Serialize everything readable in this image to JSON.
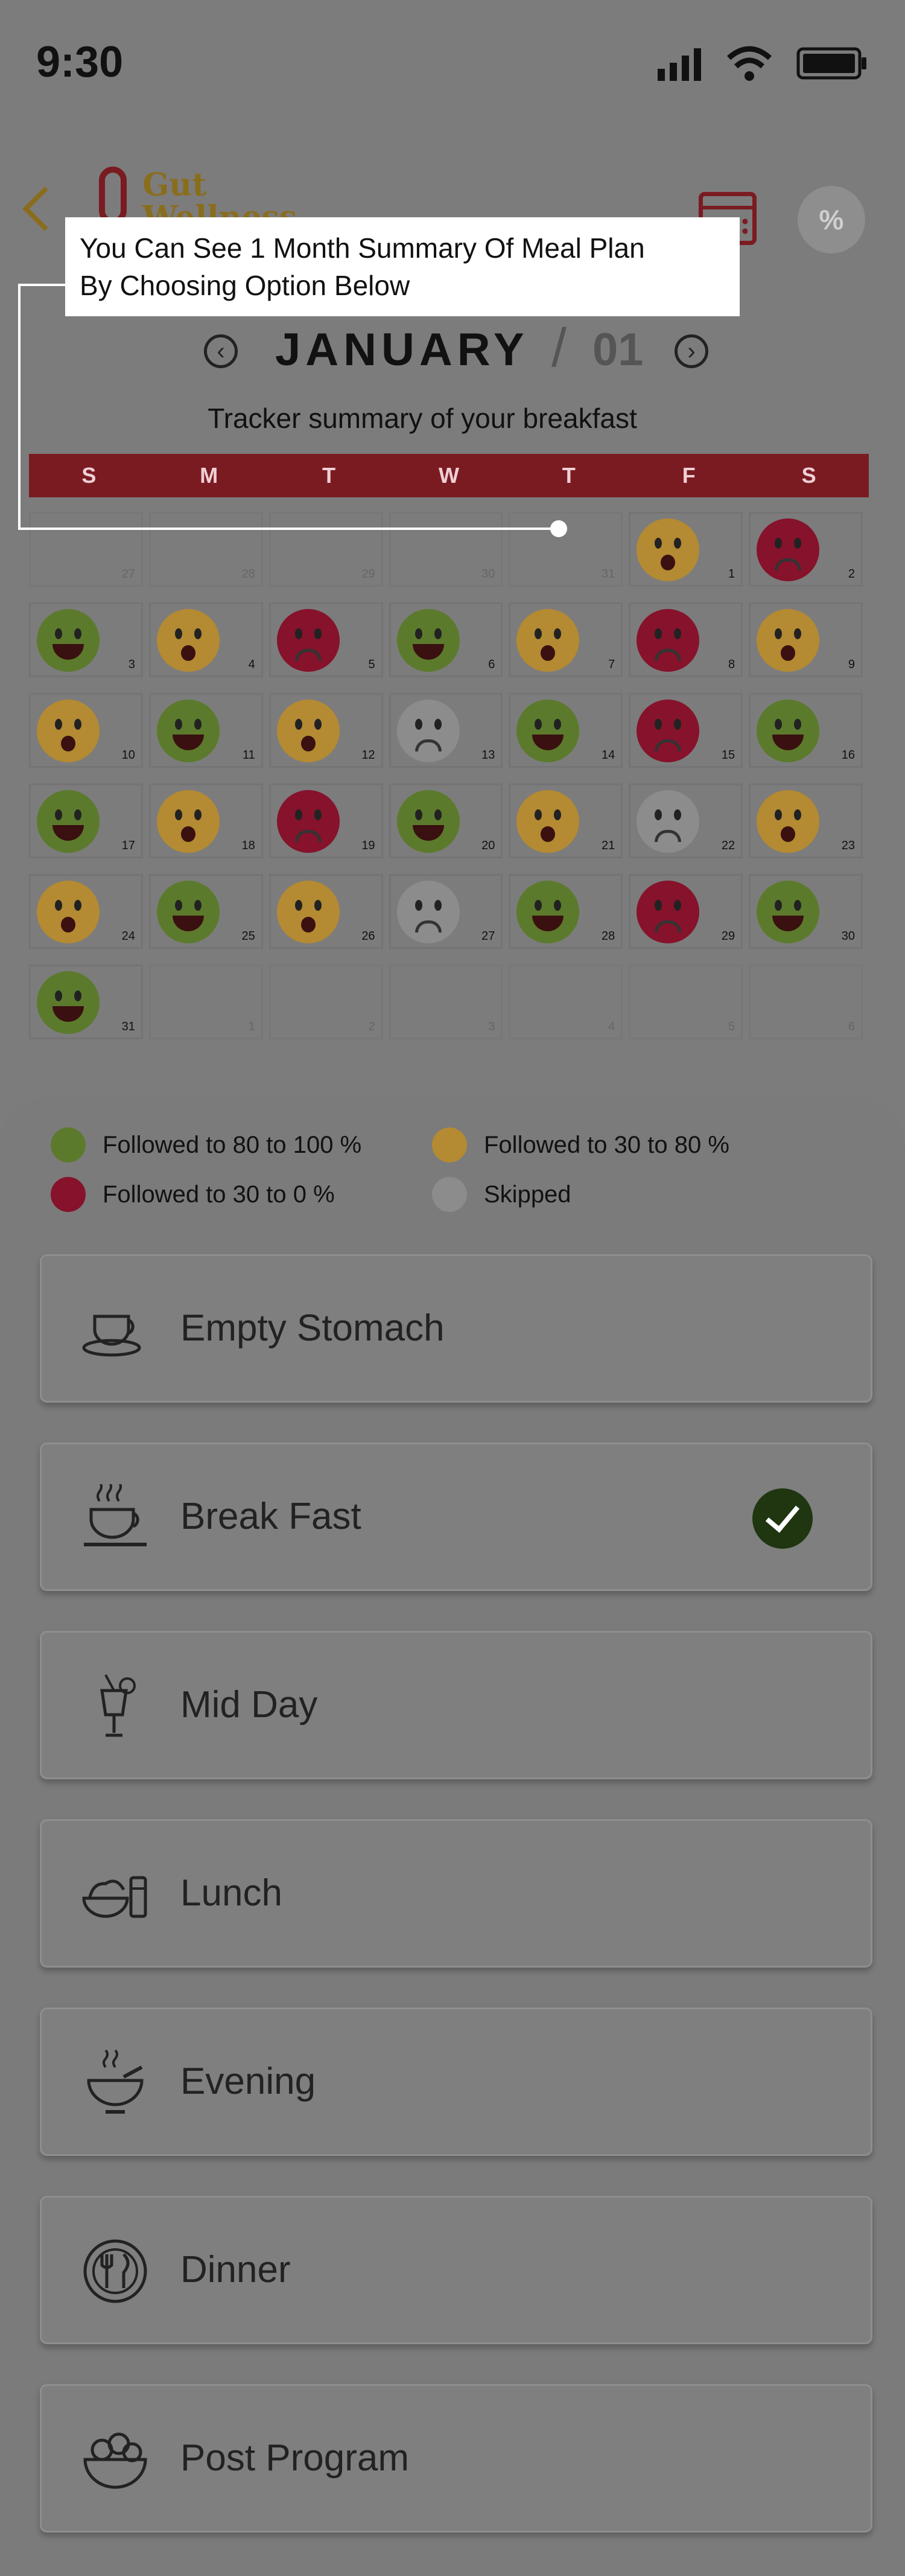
{
  "status_bar": {
    "time": "9:30"
  },
  "header": {
    "logo_line1": "Gut",
    "logo_line2": "Wellness",
    "percent_label": "%"
  },
  "tooltip": {
    "line1": "You Can See 1 Month Summary Of Meal Plan",
    "line2": "By Choosing Option Below"
  },
  "month_nav": {
    "prev": "‹",
    "next": "›",
    "month": "JANUARY",
    "slash": "/",
    "number": "01"
  },
  "subtitle": "Tracker summary of your breakfast",
  "weekdays": [
    "S",
    "M",
    "T",
    "W",
    "T",
    "F",
    "S"
  ],
  "calendar": [
    {
      "day": "27",
      "status": "none",
      "out": true
    },
    {
      "day": "28",
      "status": "none",
      "out": true
    },
    {
      "day": "29",
      "status": "none",
      "out": true
    },
    {
      "day": "30",
      "status": "none",
      "out": true
    },
    {
      "day": "31",
      "status": "none",
      "out": true
    },
    {
      "day": "1",
      "status": "yellow"
    },
    {
      "day": "2",
      "status": "red"
    },
    {
      "day": "3",
      "status": "green"
    },
    {
      "day": "4",
      "status": "yellow"
    },
    {
      "day": "5",
      "status": "red"
    },
    {
      "day": "6",
      "status": "green"
    },
    {
      "day": "7",
      "status": "yellow"
    },
    {
      "day": "8",
      "status": "red"
    },
    {
      "day": "9",
      "status": "yellow"
    },
    {
      "day": "10",
      "status": "yellow"
    },
    {
      "day": "11",
      "status": "green"
    },
    {
      "day": "12",
      "status": "yellow"
    },
    {
      "day": "13",
      "status": "skipped"
    },
    {
      "day": "14",
      "status": "green"
    },
    {
      "day": "15",
      "status": "red"
    },
    {
      "day": "16",
      "status": "green"
    },
    {
      "day": "17",
      "status": "green"
    },
    {
      "day": "18",
      "status": "yellow"
    },
    {
      "day": "19",
      "status": "red"
    },
    {
      "day": "20",
      "status": "green"
    },
    {
      "day": "21",
      "status": "yellow"
    },
    {
      "day": "22",
      "status": "skipped"
    },
    {
      "day": "23",
      "status": "yellow"
    },
    {
      "day": "24",
      "status": "yellow"
    },
    {
      "day": "25",
      "status": "green"
    },
    {
      "day": "26",
      "status": "yellow"
    },
    {
      "day": "27",
      "status": "skipped"
    },
    {
      "day": "28",
      "status": "green"
    },
    {
      "day": "29",
      "status": "red"
    },
    {
      "day": "30",
      "status": "green"
    },
    {
      "day": "31",
      "status": "green"
    },
    {
      "day": "1",
      "status": "none",
      "out": true
    },
    {
      "day": "2",
      "status": "none",
      "out": true
    },
    {
      "day": "3",
      "status": "none",
      "out": true
    },
    {
      "day": "4",
      "status": "none",
      "out": true
    },
    {
      "day": "5",
      "status": "none",
      "out": true
    },
    {
      "day": "6",
      "status": "none",
      "out": true
    }
  ],
  "legend": {
    "green": "Followed to 80 to 100 %",
    "yellow": "Followed to 30 to 80 %",
    "red": "Followed to 30 to 0 %",
    "skipped": "Skipped"
  },
  "colors": {
    "green": "#5c7a2c",
    "yellow": "#b48a32",
    "red": "#86122b",
    "skipped": "#8c8c8c",
    "header_bar": "#7a1b22"
  },
  "meals": [
    {
      "label": "Empty Stomach",
      "icon": "teacup-icon",
      "selected": false
    },
    {
      "label": "Break Fast",
      "icon": "hot-cup-icon",
      "selected": true
    },
    {
      "label": "Mid Day",
      "icon": "cocktail-icon",
      "selected": false
    },
    {
      "label": "Lunch",
      "icon": "rice-bowl-icon",
      "selected": false
    },
    {
      "label": "Evening",
      "icon": "soup-bowl-icon",
      "selected": false
    },
    {
      "label": "Dinner",
      "icon": "plate-cutlery-icon",
      "selected": false
    },
    {
      "label": "Post Program",
      "icon": "fruit-bowl-icon",
      "selected": false
    }
  ]
}
